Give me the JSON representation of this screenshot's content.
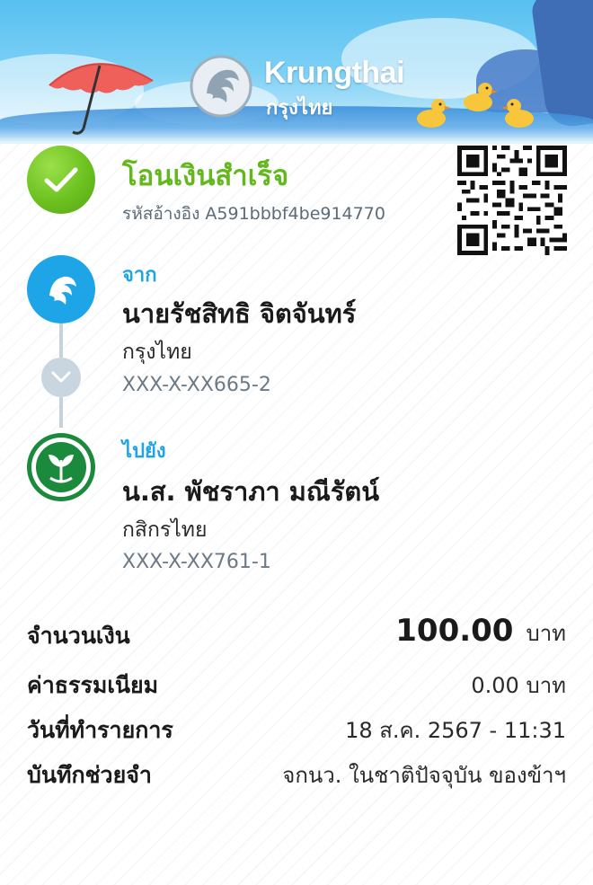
{
  "brand": {
    "name_en": "Krungthai",
    "name_th": "กรุงไทย"
  },
  "status": {
    "title": "โอนเงินสำเร็จ",
    "reference": "รหัสอ้างอิง A591bbbf4be914770",
    "icon": "check-icon",
    "color": "#64b81e"
  },
  "from": {
    "label": "จาก",
    "name": "นายรัชสิทธิ  จิตจันทร์",
    "bank": "กรุงไทย",
    "account": "XXX-X-XX665-2"
  },
  "to": {
    "label": "ไปยัง",
    "name": "น.ส. พัชราภา มณีรัตน์",
    "bank": "กสิกรไทย",
    "account": "XXX-X-XX761-1"
  },
  "details": {
    "amount_label": "จำนวนเงิน",
    "amount_value": "100.00",
    "amount_unit": "บาท",
    "fee_label": "ค่าธรรมเนียม",
    "fee_value": "0.00 บาท",
    "date_label": "วันที่ทำรายการ",
    "date_value": "18 ส.ค. 2567 - 11:31",
    "memo_label": "บันทึกช่วยจำ",
    "memo_value": "จกนว. ในชาติปัจจุบัน ของข้าฯ"
  },
  "colors": {
    "accent_blue": "#1ea5e8",
    "kbank_green": "#1b8a3c"
  }
}
